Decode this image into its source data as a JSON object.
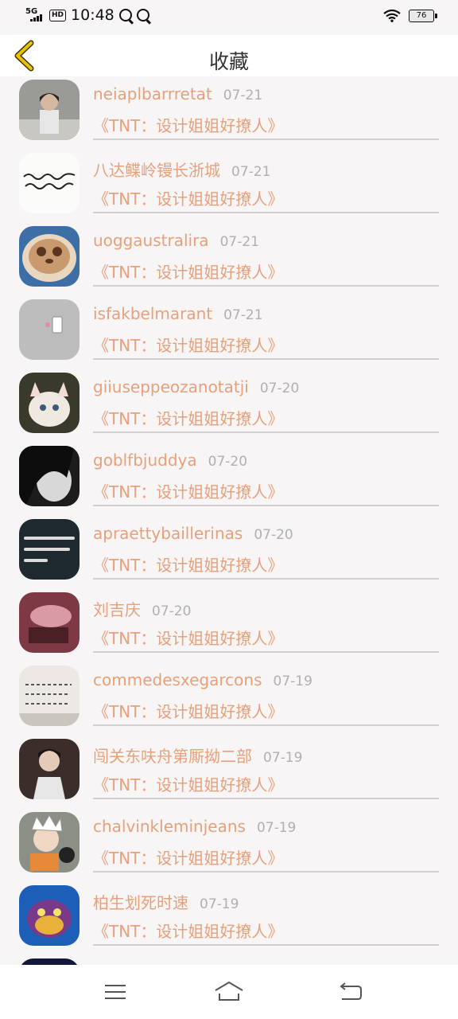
{
  "status_bar": {
    "network": "5G",
    "hd_badge": "HD",
    "time": "10:48",
    "battery": "76"
  },
  "header": {
    "title": "收藏"
  },
  "items": [
    {
      "name": "neiaplbarrretat",
      "date": "07-21",
      "book": "《TNT：设计姐姐好撩人》"
    },
    {
      "name": "八达鲽岭镘长浙城",
      "date": "07-21",
      "book": "《TNT：设计姐姐好撩人》"
    },
    {
      "name": "uoggaustralira",
      "date": "07-21",
      "book": "《TNT：设计姐姐好撩人》"
    },
    {
      "name": "isfakbelmarant",
      "date": "07-21",
      "book": "《TNT：设计姐姐好撩人》"
    },
    {
      "name": "giiuseppeozanotatji",
      "date": "07-20",
      "book": "《TNT：设计姐姐好撩人》"
    },
    {
      "name": "goblfbjuddya",
      "date": "07-20",
      "book": "《TNT：设计姐姐好撩人》"
    },
    {
      "name": "apraettybaillerinas",
      "date": "07-20",
      "book": "《TNT：设计姐姐好撩人》"
    },
    {
      "name": "刘吉庆",
      "date": "07-20",
      "book": "《TNT：设计姐姐好撩人》"
    },
    {
      "name": "commedesxegarcons",
      "date": "07-19",
      "book": "《TNT：设计姐姐好撩人》"
    },
    {
      "name": "闯关东呋舟第厮拗二部",
      "date": "07-19",
      "book": "《TNT：设计姐姐好撩人》"
    },
    {
      "name": "chalvinkleminjeans",
      "date": "07-19",
      "book": "《TNT：设计姐姐好撩人》"
    },
    {
      "name": "柏生划死时速",
      "date": "07-19",
      "book": "《TNT：设计姐姐好撩人》"
    }
  ],
  "colors": {
    "accent": "#e8a07a",
    "date": "#b0b0b0",
    "back_icon": "#e0b800",
    "background": "#f7f5f6"
  },
  "icons": {
    "back": "chevron-left-icon",
    "menu": "menu-icon",
    "home": "home-icon",
    "return": "back-arrow-icon"
  }
}
